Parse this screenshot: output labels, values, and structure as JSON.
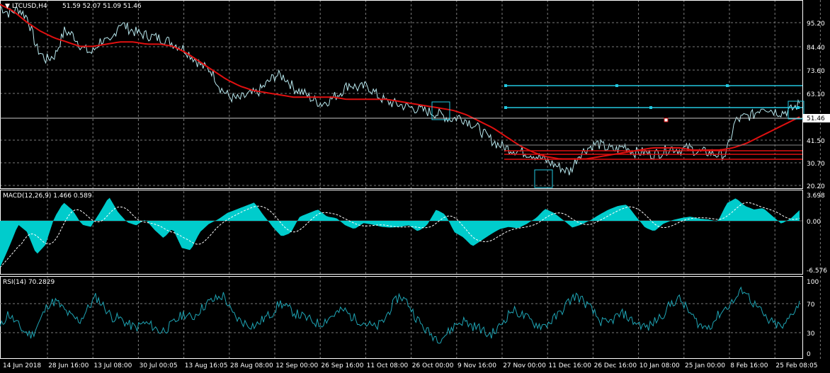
{
  "header": {
    "symbol": "LTCUSD,H4",
    "ohlc": "51.59 52.07 51.09 51.46"
  },
  "colors": {
    "background": "#000000",
    "price": "#b8e8ee",
    "ma": "#e01010",
    "macd_hist": "#00cccc",
    "macd_signal": "#ffffff",
    "rsi": "#1ea4b4",
    "hline_cyan": "#22c8e0",
    "hline_red": "#e01010",
    "grid": "#7a7a7a"
  },
  "price_panel": {
    "y_ticks": [
      "95.20",
      "84.40",
      "73.60",
      "63.10",
      "51.46",
      "41.50",
      "30.70",
      "20.20"
    ],
    "current": "51.46"
  },
  "macd_panel": {
    "label": "MACD(12,26,9) 1.466 0.589",
    "y_ticks": [
      "3.698",
      "0.00",
      "-6.576"
    ]
  },
  "rsi_panel": {
    "label": "RSI(14) 70.2829",
    "y_ticks": [
      "100",
      "70",
      "30",
      "0"
    ]
  },
  "x_axis": {
    "ticks": [
      "14 Jun 2018",
      "28 Jun 16:00",
      "13 Jul 08:00",
      "30 Jul 00:05",
      "13 Aug 16:05",
      "28 Aug 08:00",
      "12 Sep 00:00",
      "26 Sep 16:00",
      "11 Oct 08:00",
      "26 Oct 00:00",
      "9 Nov 16:00",
      "27 Nov 00:00",
      "11 Dec 16:00",
      "26 Dec 16:00",
      "10 Jan 08:00",
      "25 Jan 00:00",
      "8 Feb 16:00",
      "25 Feb 08:05"
    ]
  },
  "chart_data": {
    "type": "line",
    "x_range": [
      "14 Jun 2018",
      "25 Feb 08:05"
    ],
    "series": [
      {
        "values": [
          97,
          94,
          96,
          92,
          78,
          73,
          75,
          86,
          84,
          78,
          76,
          82,
          80,
          90,
          87,
          85,
          84,
          83,
          82,
          80,
          78,
          74,
          70,
          68,
          60,
          56,
          55,
          57,
          58,
          62,
          66,
          65,
          60,
          58,
          55,
          53,
          55,
          58,
          62,
          60,
          61,
          57,
          54,
          53,
          52,
          51,
          50,
          49,
          48,
          46,
          47,
          45,
          42,
          38,
          35,
          33,
          32,
          31,
          30,
          28,
          26,
          24,
          22,
          30,
          33,
          35,
          33,
          32,
          34,
          31,
          31,
          30,
          31,
          33,
          32,
          33,
          31,
          31,
          30,
          30,
          45,
          47,
          48,
          52,
          50,
          49,
          50,
          53
        ]
      },
      {
        "values": [
          98,
          95,
          90,
          86,
          83,
          81,
          79,
          79,
          80,
          81,
          81,
          80,
          80,
          79,
          76,
          72,
          68,
          64,
          61,
          59,
          58,
          57,
          56,
          56,
          56,
          56,
          55,
          55,
          55,
          55,
          54,
          53,
          52,
          51,
          50,
          48,
          45,
          42,
          38,
          34,
          31,
          29,
          28,
          28,
          28,
          29,
          30,
          31,
          32,
          33,
          33,
          33,
          32,
          32,
          32,
          33,
          35,
          38,
          41,
          44,
          47
        ]
      },
      {
        "name": "MACD(12,26,9)",
        "values": [
          -6.2,
          -3.5,
          -0.5,
          -1.5,
          -4.5,
          -3.2,
          0.5,
          2.6,
          1.5,
          -0.5,
          -0.8,
          1.2,
          3.4,
          1.2,
          -0.2,
          -0.6,
          0.2,
          -1.2,
          -2.3,
          -1.0,
          -3.6,
          -3.9,
          -1.5,
          -0.4,
          0.2,
          1.1,
          1.6,
          2.1,
          2.6,
          0.8,
          -0.8,
          -2.1,
          -1.6,
          0.6,
          1.1,
          1.6,
          0.6,
          0.4,
          -0.6,
          -1.1,
          -0.3,
          -0.5,
          -0.8,
          -0.9,
          -0.8,
          -0.6,
          -1.4,
          -0.6,
          1.6,
          0.9,
          -1.5,
          -2.2,
          -3.4,
          -2.6,
          -1.8,
          -1.1,
          -0.8,
          -1.0,
          -0.4,
          0.4,
          1.7,
          1.1,
          0.1,
          -0.9,
          -0.5,
          0.1,
          0.9,
          1.6,
          2.1,
          2.3,
          0.6,
          -0.9,
          -1.4,
          -0.4,
          0.1,
          0.4,
          0.6,
          0.3,
          0.2,
          -0.1,
          2.5,
          3.2,
          2.1,
          1.6,
          1.8,
          0.7,
          -0.4,
          0.3,
          1.5
        ]
      },
      {
        "name": "RSI(14)",
        "values": [
          35,
          55,
          42,
          30,
          25,
          45,
          68,
          72,
          60,
          50,
          45,
          62,
          78,
          65,
          50,
          48,
          40,
          35,
          42,
          38,
          30,
          35,
          45,
          55,
          48,
          60,
          70,
          75,
          80,
          55,
          45,
          40,
          38,
          48,
          55,
          70,
          62,
          55,
          50,
          45,
          40,
          48,
          55,
          60,
          50,
          45,
          40,
          35,
          45,
          65,
          80,
          70,
          50,
          35,
          25,
          20,
          28,
          40,
          45,
          38,
          35,
          25,
          30,
          45,
          60,
          55,
          48,
          40,
          38,
          45,
          55,
          70,
          80,
          72,
          60,
          45,
          40,
          50,
          55,
          45,
          40,
          35,
          45,
          55,
          70,
          75,
          60,
          45,
          35,
          40,
          55,
          65,
          75,
          90,
          72,
          60,
          45,
          40,
          35,
          55,
          70
        ]
      }
    ]
  }
}
